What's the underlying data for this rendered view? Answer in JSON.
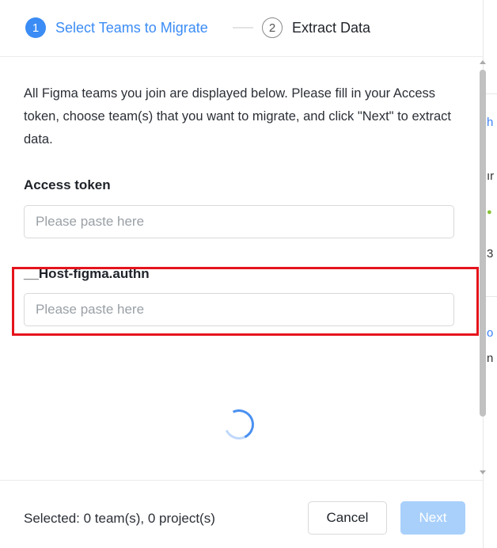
{
  "steps": [
    {
      "number": "1",
      "label": "Select Teams to Migrate",
      "state": "active"
    },
    {
      "number": "2",
      "label": "Extract Data",
      "state": "pending"
    }
  ],
  "description": "All Figma teams you join are displayed below. Please fill in your Access token, choose team(s) that you want to migrate, and click \"Next\" to extract data.",
  "fields": {
    "access_token": {
      "label": "Access token",
      "value": "",
      "placeholder": "Please paste here"
    },
    "host_figma_authn": {
      "label": "__Host-figma.authn",
      "value": "",
      "placeholder": "Please paste here"
    }
  },
  "footer": {
    "selected_text": "Selected: 0 team(s), 0 project(s)",
    "cancel_label": "Cancel",
    "next_label": "Next"
  },
  "background_fragments": [
    "h",
    "ır",
    "3",
    "o",
    "n"
  ],
  "colors": {
    "accent": "#3b8cf5",
    "next_disabled": "#a9d0fb",
    "highlight_box": "#e5141c"
  }
}
